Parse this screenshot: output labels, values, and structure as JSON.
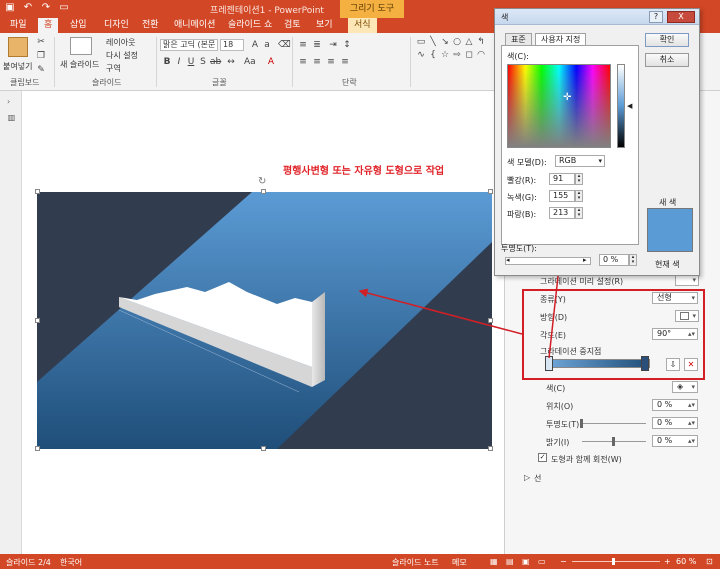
{
  "titlebar": {
    "title": "프레젠테이션1 - PowerPoint",
    "context_tab": "그리기 도구"
  },
  "tabs": [
    {
      "label": "파일"
    },
    {
      "label": "홈"
    },
    {
      "label": "삽입"
    },
    {
      "label": "디자인"
    },
    {
      "label": "전환"
    },
    {
      "label": "애니메이션"
    },
    {
      "label": "슬라이드 쇼"
    },
    {
      "label": "검토"
    },
    {
      "label": "보기"
    },
    {
      "label": "서식"
    }
  ],
  "ribbon": {
    "paste_label": "붙여넣기",
    "clipboard_group": "클립보드",
    "new_slide_label": "새 슬라이드",
    "layout_label": "레이아웃",
    "reset_label": "다시 설정",
    "section_label": "구역",
    "slides_group": "슬라이드",
    "font_name": "맑은 고딕 (본문",
    "font_size": "18",
    "font_group": "글꼴",
    "paragraph_group": "단락"
  },
  "canvas": {
    "annotation": "평행사변형 또는 자유형 도형으로 작업"
  },
  "color_dialog": {
    "title": "색",
    "help_button": "?",
    "close_button": "X",
    "tab_standard": "표준",
    "tab_custom": "사용자 지정",
    "colors_label": "색(C):",
    "color_model_label": "색 모델(D):",
    "color_model_value": "RGB",
    "red_label": "빨강(R):",
    "red_value": "91",
    "green_label": "녹색(G):",
    "green_value": "155",
    "blue_label": "파랑(B):",
    "blue_value": "213",
    "transparency_label": "투명도(T):",
    "transparency_value": "0 %",
    "ok_button": "확인",
    "cancel_button": "취소",
    "new_label": "새 색",
    "current_label": "현재 색",
    "new_color": "#5b9bd5",
    "current_color": "#5b9bd5"
  },
  "format_pane": {
    "preset_label": "그라데이션 미리 설정(R)",
    "type_label": "종류(Y)",
    "type_value": "선형",
    "direction_label": "방향(D)",
    "angle_label": "각도(E)",
    "angle_value": "90°",
    "stops_label": "그라데이션 중지점",
    "color_label": "색(C)",
    "position_label": "위치(O)",
    "position_value": "0 %",
    "transparency_label": "투명도(T)",
    "transparency_value": "0 %",
    "brightness_label": "밝기(I)",
    "brightness_value": "0 %",
    "rotate_label": "도형과 함께 회전(W)",
    "line_section": "선"
  },
  "statusbar": {
    "slide_info": "슬라이드 2/4",
    "language": "한국어",
    "notes": "슬라이드 노트",
    "comments": "메모",
    "zoom": "60 %"
  }
}
